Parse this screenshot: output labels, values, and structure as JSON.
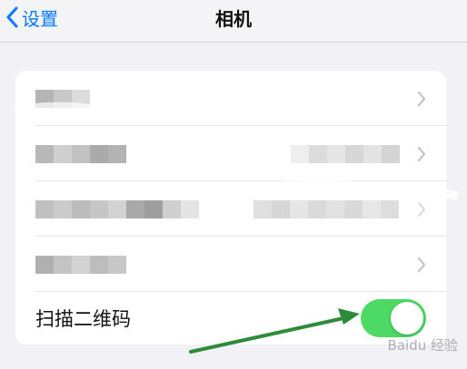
{
  "navbar": {
    "back_label": "设置",
    "title": "相机"
  },
  "settings": {
    "qr_scan_label": "扫描二维码",
    "qr_scan_enabled": true
  },
  "colors": {
    "accent": "#007aff",
    "toggle_on": "#4cd964",
    "annotation_arrow": "#2e8b3a",
    "background": "#f2f2f6"
  },
  "watermark": "Baidu 经验"
}
